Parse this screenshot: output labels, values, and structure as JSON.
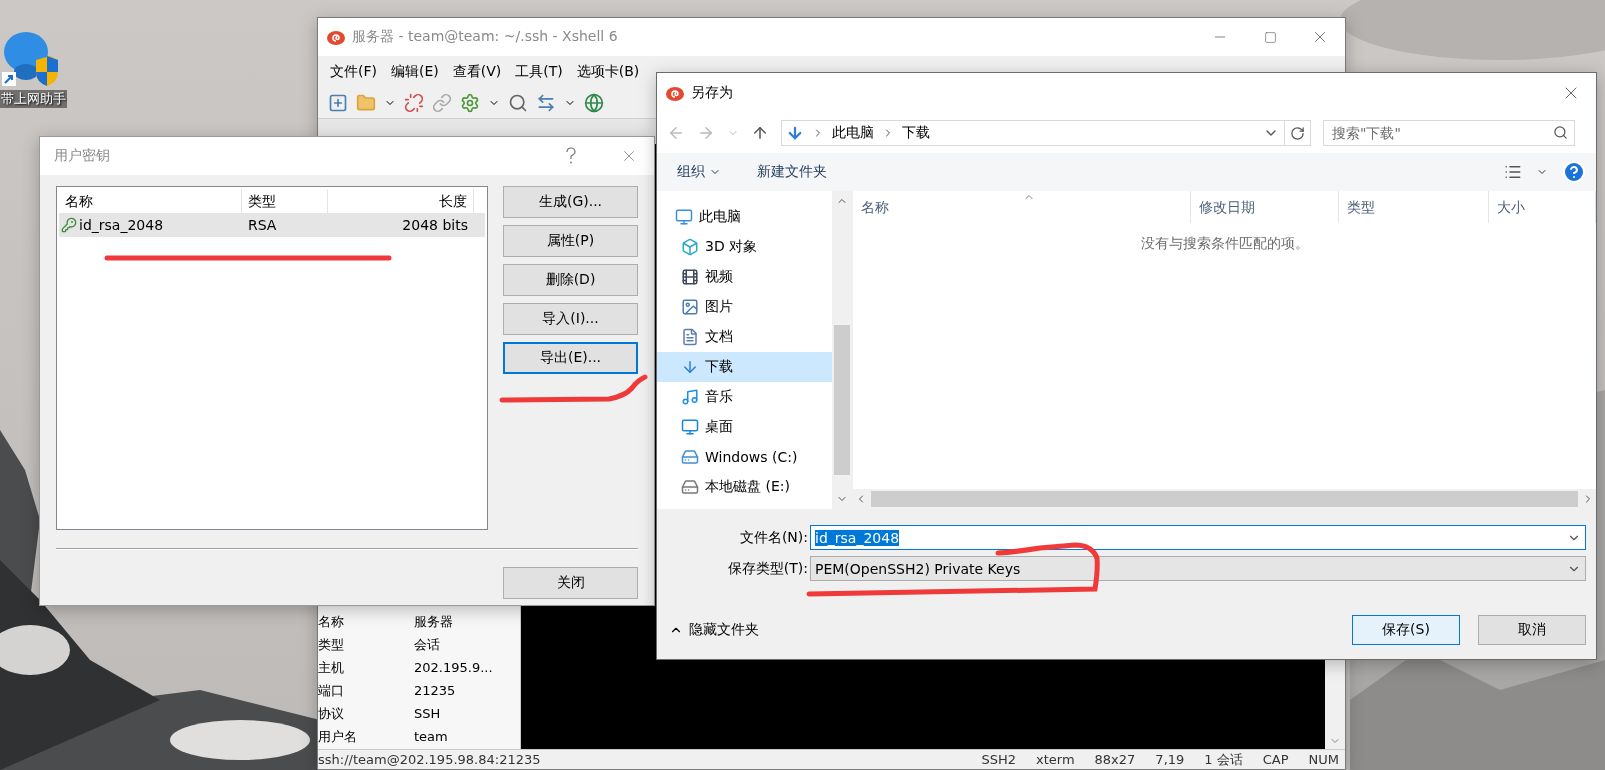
{
  "desktop": {
    "icons": [
      {
        "label": "带上网助手"
      }
    ]
  },
  "xshell": {
    "title": "服务器 - team@team: ~/.ssh - Xshell 6",
    "menu": [
      "文件(F)",
      "编辑(E)",
      "查看(V)",
      "工具(T)",
      "选项卡(B)"
    ],
    "session_info": [
      {
        "key": "名称",
        "value": "服务器"
      },
      {
        "key": "类型",
        "value": "会话"
      },
      {
        "key": "主机",
        "value": "202.195.9..."
      },
      {
        "key": "端口",
        "value": "21235"
      },
      {
        "key": "协议",
        "value": "SSH"
      },
      {
        "key": "用户名",
        "value": "team"
      }
    ],
    "status_bar": {
      "path": "ssh://team@202.195.98.84:21235",
      "items": [
        "SSH2",
        "xterm",
        "88x27",
        "7,19",
        "1 会话",
        "CAP",
        "NUM"
      ]
    }
  },
  "user_keys_dialog": {
    "title": "用户密钥",
    "columns": [
      "名称",
      "类型",
      "长度"
    ],
    "rows": [
      {
        "cells": [
          "id_rsa_2048",
          "RSA",
          "2048 bits"
        ],
        "selected": true
      }
    ],
    "buttons": [
      {
        "label": "生成(G)...",
        "focused": false
      },
      {
        "label": "属性(P)",
        "focused": false
      },
      {
        "label": "删除(D)",
        "focused": false
      },
      {
        "label": "导入(I)...",
        "focused": false
      },
      {
        "label": "导出(E)...",
        "focused": true
      }
    ],
    "close_button": "关闭"
  },
  "save_dialog": {
    "title": "另存为",
    "breadcrumb": [
      "此电脑",
      "下载"
    ],
    "search": {
      "placeholder": "搜索\"下载\""
    },
    "toolbar": [
      "组织",
      "新建文件夹"
    ],
    "nav": [
      {
        "label": "此电脑",
        "kind": "pc",
        "selected": false,
        "children": [
          {
            "label": "3D 对象",
            "kind": "objects",
            "selected": false
          },
          {
            "label": "视频",
            "kind": "video",
            "selected": false
          },
          {
            "label": "图片",
            "kind": "pictures",
            "selected": false
          },
          {
            "label": "文档",
            "kind": "documents",
            "selected": false
          },
          {
            "label": "下载",
            "kind": "downloads",
            "selected": true
          },
          {
            "label": "音乐",
            "kind": "music",
            "selected": false
          },
          {
            "label": "桌面",
            "kind": "desktop",
            "selected": false
          },
          {
            "label": "Windows (C:)",
            "kind": "system-drive",
            "selected": false
          },
          {
            "label": "本地磁盘 (E:)",
            "kind": "drive",
            "selected": false
          }
        ]
      }
    ],
    "columns": [
      "名称",
      "修改日期",
      "类型",
      "大小"
    ],
    "empty_message": "没有与搜索条件匹配的项。",
    "file_name": {
      "label": "文件名(N):",
      "value": "id_rsa_2048",
      "text_selected": true
    },
    "file_type": {
      "label": "保存类型(T):",
      "value": "PEM(OpenSSH2) Private Keys"
    },
    "hide_folders": "隐藏文件夹",
    "buttons": [
      {
        "label": "保存(S)",
        "default": true
      },
      {
        "label": "取消",
        "default": false
      }
    ]
  }
}
